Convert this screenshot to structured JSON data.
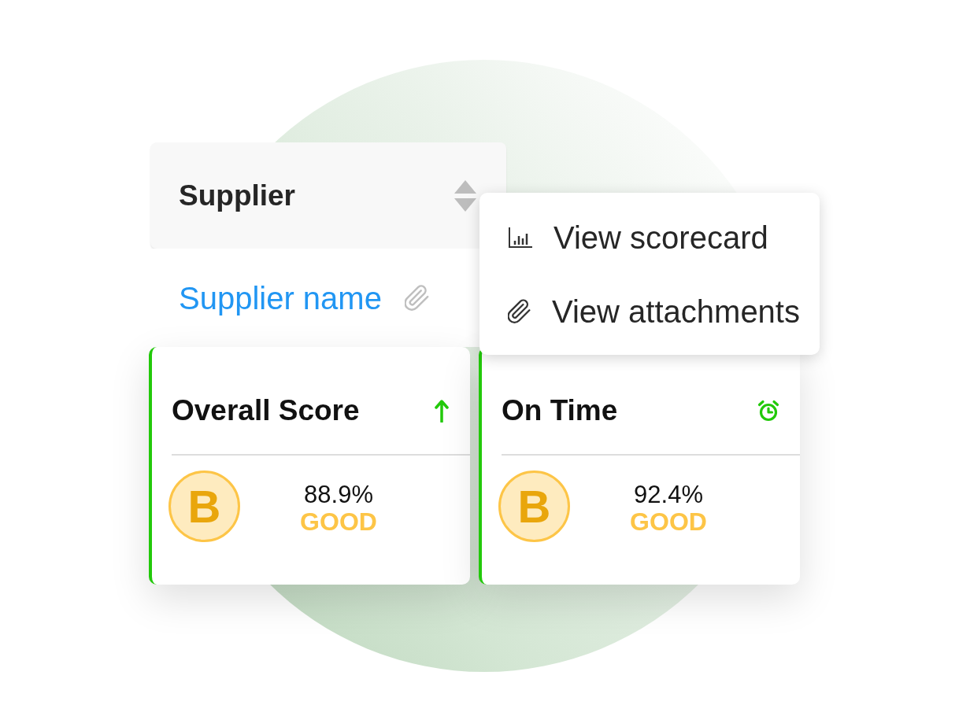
{
  "column_header": {
    "label": "Supplier"
  },
  "supplier_link": {
    "label": "Supplier name"
  },
  "context_menu": {
    "items": [
      {
        "kind": "scorecard",
        "label": "View scorecard"
      },
      {
        "kind": "attachments",
        "label": "View attachments"
      }
    ]
  },
  "score_cards": [
    {
      "kind": "trend",
      "title": "Overall Score",
      "grade": "B",
      "value": "88.9%",
      "rating": "GOOD"
    },
    {
      "kind": "timer",
      "title": "On Time",
      "grade": "B",
      "value": "92.4%",
      "rating": "GOOD"
    }
  ]
}
